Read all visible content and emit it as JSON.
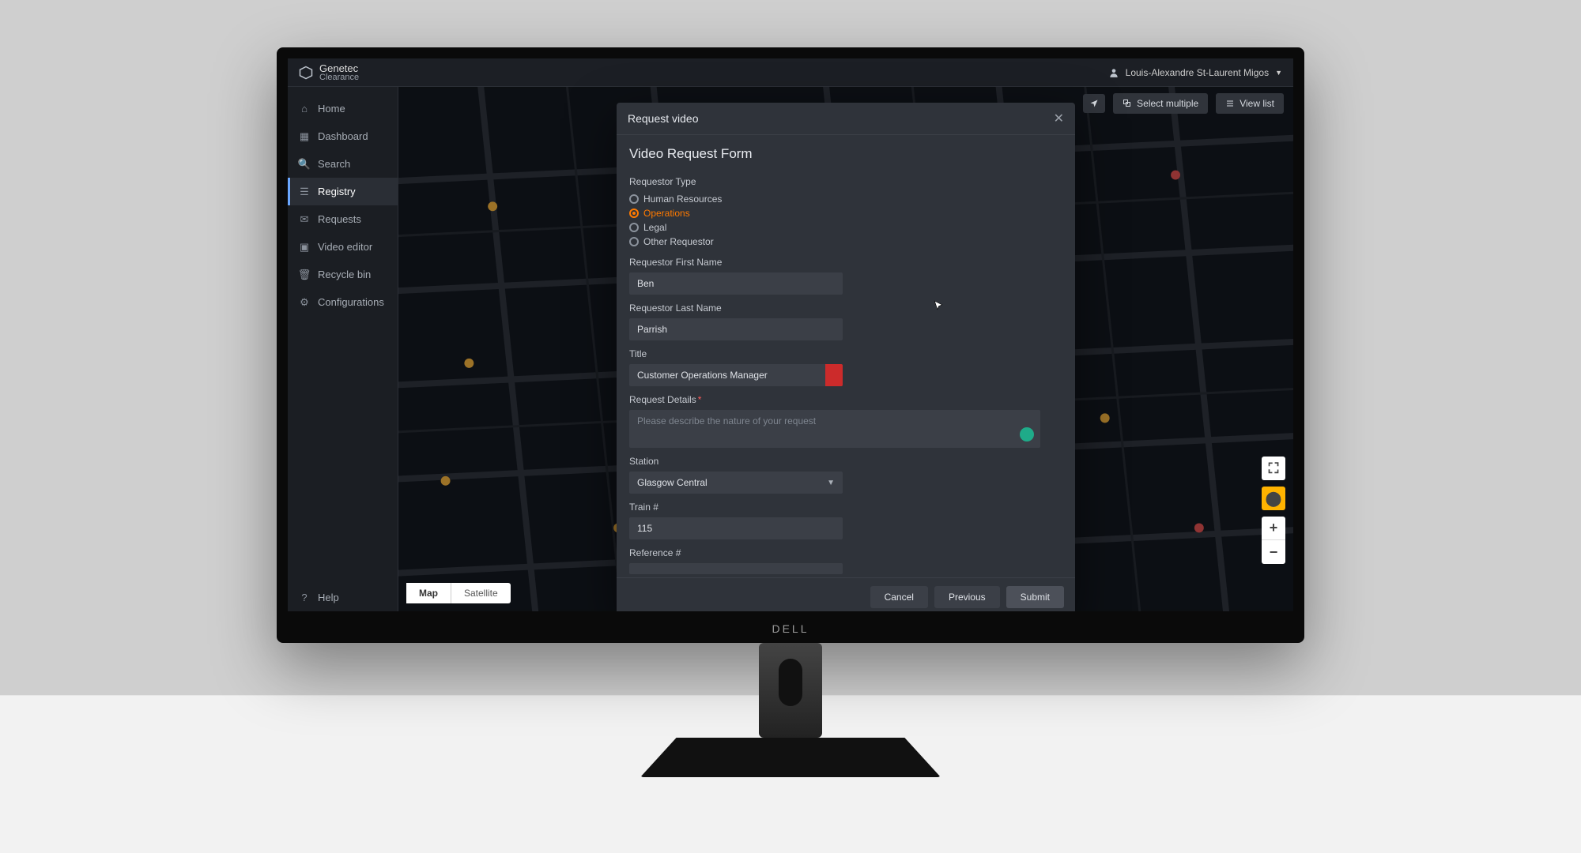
{
  "app": {
    "brand_top": "Genetec",
    "brand_bottom": "Clearance"
  },
  "user": {
    "name": "Louis-Alexandre St-Laurent Migos"
  },
  "sidebar": {
    "items": [
      {
        "label": "Home"
      },
      {
        "label": "Dashboard"
      },
      {
        "label": "Search"
      },
      {
        "label": "Registry"
      },
      {
        "label": "Requests"
      },
      {
        "label": "Video editor"
      },
      {
        "label": "Recycle bin"
      },
      {
        "label": "Configurations"
      }
    ],
    "help": "Help"
  },
  "mapbar": {
    "select_multiple": "Select multiple",
    "view_list": "View list"
  },
  "mapswitch": {
    "map": "Map",
    "satellite": "Satellite"
  },
  "modal": {
    "title": "Request video",
    "form_title": "Video Request Form",
    "labels": {
      "requestor_type": "Requestor Type",
      "first_name": "Requestor First Name",
      "last_name": "Requestor Last Name",
      "title": "Title",
      "request_details": "Request Details",
      "station": "Station",
      "train": "Train #",
      "reference": "Reference #"
    },
    "requestor_types": [
      "Human Resources",
      "Operations",
      "Legal",
      "Other Requestor"
    ],
    "requestor_type_selected": "Operations",
    "values": {
      "first_name": "Ben",
      "last_name": "Parrish",
      "title": "Customer Operations Manager",
      "request_details_placeholder": "Please describe the nature of your request",
      "station": "Glasgow Central",
      "train": "115",
      "reference": ""
    },
    "buttons": {
      "cancel": "Cancel",
      "previous": "Previous",
      "submit": "Submit"
    }
  },
  "monitor_brand": "DELL"
}
